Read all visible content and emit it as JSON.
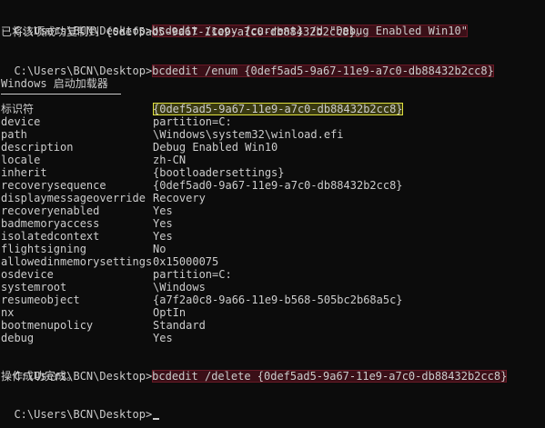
{
  "terminal": {
    "prompt": "C:\\Users\\BCN\\Desktop>",
    "cmd_copy": "bcdedit /copy {current} /d \"Debug Enabled Win10\"",
    "copy_result": "已将该项成功复制到 {0def5ad5-9a67-11e9-a7c0-db88432b2cc8}。",
    "cmd_enum": "bcdedit /enum {0def5ad5-9a67-11e9-a7c0-db88432b2cc8}",
    "section_heading": "Windows 启动加载器",
    "entries": [
      {
        "key": "标识符",
        "value": "{0def5ad5-9a67-11e9-a7c0-db88432b2cc8}"
      },
      {
        "key": "device",
        "value": "partition=C:"
      },
      {
        "key": "path",
        "value": "\\Windows\\system32\\winload.efi"
      },
      {
        "key": "description",
        "value": "Debug Enabled Win10"
      },
      {
        "key": "locale",
        "value": "zh-CN"
      },
      {
        "key": "inherit",
        "value": "{bootloadersettings}"
      },
      {
        "key": "recoverysequence",
        "value": "{0def5ad0-9a67-11e9-a7c0-db88432b2cc8}"
      },
      {
        "key": "displaymessageoverride",
        "value": "Recovery"
      },
      {
        "key": "recoveryenabled",
        "value": "Yes"
      },
      {
        "key": "badmemoryaccess",
        "value": "Yes"
      },
      {
        "key": "isolatedcontext",
        "value": "Yes"
      },
      {
        "key": "flightsigning",
        "value": "No"
      },
      {
        "key": "allowedinmemorysettings",
        "value": "0x15000075"
      },
      {
        "key": "osdevice",
        "value": "partition=C:"
      },
      {
        "key": "systemroot",
        "value": "\\Windows"
      },
      {
        "key": "resumeobject",
        "value": "{a7f2a0c8-9a66-11e9-b568-505bc2b68a5c}"
      },
      {
        "key": "nx",
        "value": "OptIn"
      },
      {
        "key": "bootmenupolicy",
        "value": "Standard"
      },
      {
        "key": "debug",
        "value": "Yes"
      }
    ],
    "cmd_delete": "bcdedit /delete {0def5ad5-9a67-11e9-a7c0-db88432b2cc8}",
    "delete_result": "操作成功完成。"
  },
  "colors": {
    "background": "#0c0c0c",
    "text": "#cccccc",
    "command_highlight": "#3a0f17",
    "id_highlight_border": "#e0e040"
  }
}
